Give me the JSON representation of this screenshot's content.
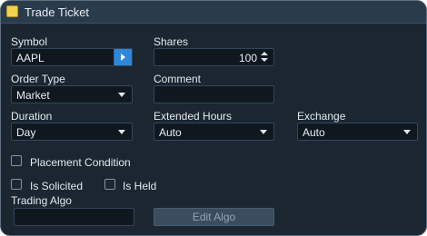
{
  "window": {
    "title": "Trade Ticket",
    "icon": "ticket-icon"
  },
  "symbol": {
    "label": "Symbol",
    "value": "AAPL",
    "go_icon": "arrow-right-icon"
  },
  "shares": {
    "label": "Shares",
    "value": "100"
  },
  "order_type": {
    "label": "Order Type",
    "value": "Market"
  },
  "comment": {
    "label": "Comment",
    "value": ""
  },
  "duration": {
    "label": "Duration",
    "value": "Day"
  },
  "extended_hours": {
    "label": "Extended Hours",
    "value": "Auto"
  },
  "exchange": {
    "label": "Exchange",
    "value": "Auto"
  },
  "checkboxes": {
    "placement_condition": "Placement Condition",
    "is_solicited": "Is Solicited",
    "is_held": "Is Held"
  },
  "trading_algo": {
    "label": "Trading Algo",
    "value": "",
    "edit_button": "Edit Algo"
  },
  "colors": {
    "background": "#1b2631",
    "accent": "#2e86d8",
    "title_icon": "#f2d14c"
  }
}
